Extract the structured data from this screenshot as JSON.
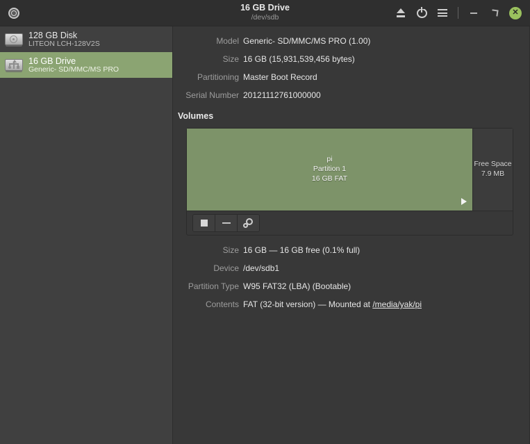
{
  "titlebar": {
    "app_icon": "disk-platter-icon",
    "title": "16 GB Drive",
    "subtitle": "/dev/sdb",
    "buttons": {
      "eject": "eject-icon",
      "power": "power-icon",
      "menu": "hamburger-menu-icon",
      "minimize": "minimize-icon",
      "maximize": "maximize-icon",
      "close": "✕"
    },
    "close_color": "#9ac15e"
  },
  "sidebar": {
    "devices": [
      {
        "name": "128 GB Disk",
        "model": "LITEON LCH-128V2S",
        "icon": "hard-disk-icon",
        "selected": false
      },
      {
        "name": "16 GB Drive",
        "model": "Generic- SD/MMC/MS PRO",
        "icon": "usb-drive-icon",
        "selected": true
      }
    ],
    "selected_color": "#8ba472"
  },
  "drive_details": {
    "rows": [
      {
        "label": "Model",
        "value": "Generic- SD/MMC/MS PRO (1.00)"
      },
      {
        "label": "Size",
        "value": "16 GB (15,931,539,456 bytes)"
      },
      {
        "label": "Partitioning",
        "value": "Master Boot Record"
      },
      {
        "label": "Serial Number",
        "value": "20121112761000000"
      }
    ]
  },
  "volumes": {
    "section_title": "Volumes",
    "partitions": [
      {
        "name": "pi",
        "number": "Partition 1",
        "size_fs": "16 GB FAT",
        "color": "#7d9369",
        "selected": true
      },
      {
        "name": "Free Space",
        "size": "7.9 MB",
        "color": "#3c3c3c",
        "selected": false
      }
    ],
    "toolbar": [
      {
        "name": "unmount-button",
        "icon": "stop-square-icon"
      },
      {
        "name": "delete-partition-button",
        "icon": "minus-icon"
      },
      {
        "name": "more-actions-button",
        "icon": "gears-icon"
      }
    ]
  },
  "volume_details": {
    "rows": [
      {
        "label": "Size",
        "value": "16 GB — 16 GB free (0.1% full)"
      },
      {
        "label": "Device",
        "value": "/dev/sdb1"
      },
      {
        "label": "Partition Type",
        "value": "W95 FAT32 (LBA) (Bootable)"
      },
      {
        "label": "Contents",
        "value": "FAT (32-bit version) — Mounted at ",
        "link": "/media/yak/pi"
      }
    ]
  }
}
